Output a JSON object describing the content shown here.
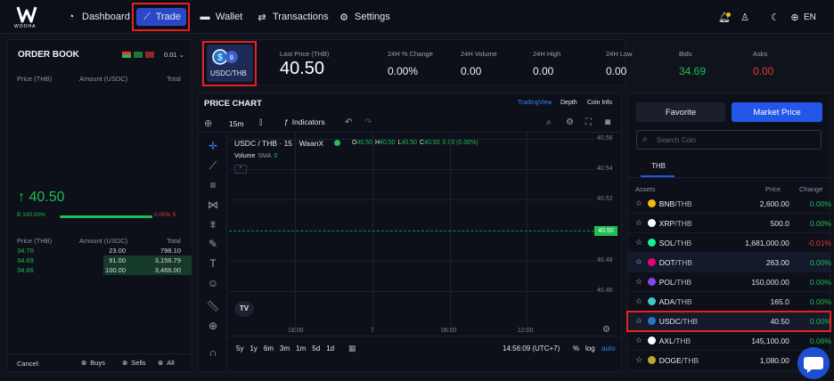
{
  "brand": {
    "logo_text": "WOOHA"
  },
  "nav": {
    "dashboard": "Dashboard",
    "trade": "Trade",
    "wallet": "Wallet",
    "transactions": "Transactions",
    "settings": "Settings",
    "lang": "EN"
  },
  "colors": {
    "accent": "#2a47c8",
    "up": "#1fbd52",
    "down": "#e53935",
    "highlight_box": "#e32222"
  },
  "orderbook": {
    "title": "ORDER BOOK",
    "precision": "0.01",
    "headers": {
      "price": "Price (THB)",
      "amount": "Amount (USDC)",
      "total": "Total"
    },
    "last_price": "↑ 40.50",
    "buy_pct": "B 100.00%",
    "sell_pct": "0.00% S",
    "buy_fraction": 1.0,
    "bids": [
      {
        "price": "34.70",
        "amount": "23.00",
        "total": "798.10"
      },
      {
        "price": "34.69",
        "amount": "91.00",
        "total": "3,156.79"
      },
      {
        "price": "34.66",
        "amount": "100.00",
        "total": "3,466.00"
      }
    ],
    "cancel": {
      "label": "Cancel:",
      "buys": "Buys",
      "sells": "Sells",
      "all": "All"
    }
  },
  "market": {
    "pair": "USDC/THB",
    "stats": [
      {
        "label": "Last Price (THB)",
        "value": "40.50"
      },
      {
        "label": "24H % Change",
        "value": "0.00%"
      },
      {
        "label": "24H Volume",
        "value": "0.00"
      },
      {
        "label": "24H High",
        "value": "0.00"
      },
      {
        "label": "24H Low",
        "value": "0.00"
      },
      {
        "label": "Bids",
        "value": "34.69"
      },
      {
        "label": "Asks",
        "value": "0.00"
      }
    ]
  },
  "chart": {
    "title": "PRICE CHART",
    "tabs": [
      "TradingView",
      "Depth",
      "Coin Info"
    ],
    "interval": "15m",
    "indicators": "Indicators",
    "symbol": "USDC / THB · 15 · WaanX",
    "ohlc": {
      "o": "O",
      "o_val": "40.50",
      "h": "H",
      "h_val": "40.50",
      "l": "L",
      "l_val": "40.50",
      "c": "C",
      "c_val": "40.50",
      "chg": "0.00 (0.00%)"
    },
    "volume": "Volume",
    "sma": "SMA",
    "vol_val": "0",
    "y_ticks": [
      "40.56",
      "40.54",
      "40.52",
      "40.50",
      "40.48",
      "40.46"
    ],
    "x_ticks": [
      "18:00",
      "7",
      "06:00",
      "12:00"
    ],
    "ranges": [
      "5y",
      "1y",
      "6m",
      "3m",
      "1m",
      "5d",
      "1d"
    ],
    "clock": "14:56:09 (UTC+7)",
    "pct": "%",
    "log": "log",
    "auto": "auto",
    "last_price_label": "40.50"
  },
  "markets": {
    "tabs": {
      "favorite": "Favorite",
      "market_price": "Market Price"
    },
    "search_placeholder": "Search Coin",
    "quote_tab": "THB",
    "headers": {
      "assets": "Assets",
      "price": "Price",
      "change": "Change"
    },
    "rows": [
      {
        "base": "BNB",
        "quote": "/THB",
        "price": "2,600.00",
        "change": "0.00%",
        "color": "#f0b90b"
      },
      {
        "base": "XRP",
        "quote": "/THB",
        "price": "500.0",
        "change": "0.00%",
        "color": "#ffffff"
      },
      {
        "base": "SOL",
        "quote": "/THB",
        "price": "1,681,000.00",
        "change": "-0.01%",
        "color": "#14f195"
      },
      {
        "base": "DOT",
        "quote": "/THB",
        "price": "263.00",
        "change": "0.00%",
        "color": "#e6007a"
      },
      {
        "base": "POL",
        "quote": "/THB",
        "price": "150,000.00",
        "change": "0.00%",
        "color": "#8247e5"
      },
      {
        "base": "ADA",
        "quote": "/THB",
        "price": "165.0",
        "change": "0.00%",
        "color": "#3cc8c8"
      },
      {
        "base": "USDC",
        "quote": "/THB",
        "price": "40.50",
        "change": "0.00%",
        "color": "#2775ca"
      },
      {
        "base": "AXL",
        "quote": "/THB",
        "price": "145,100.00",
        "change": "0.06%",
        "color": "#ffffff"
      },
      {
        "base": "DOGE",
        "quote": "/THB",
        "price": "1,080.00",
        "change": "",
        "color": "#c2a633"
      }
    ]
  }
}
